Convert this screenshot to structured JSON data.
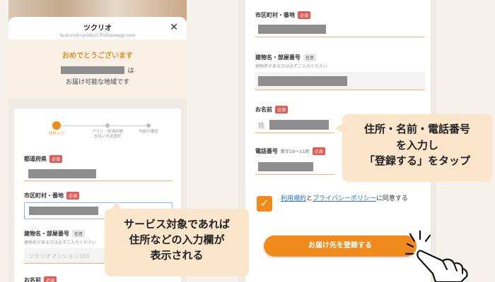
{
  "left": {
    "modal_title": "ツクリオ",
    "modal_url": "tsukurioki-product.firebaseapp.com",
    "congrats_title": "おめでとうございます",
    "congrats_suffix": "は",
    "congrats_sub": "お届け可能な地域です",
    "steps": [
      "住所入力",
      "プラン・配達時間\n支払い方法選択",
      "内容の確認"
    ],
    "fields": {
      "prefecture_label": "都道府県",
      "city_label": "市区町村・番地",
      "building_label": "建物名・部屋番号",
      "building_hint": "建物名がある方は必ずご入力ください",
      "building_placeholder": "ツクリオマンション101",
      "name_label": "お名前"
    },
    "required_badge": "必須",
    "optional_badge": "任意"
  },
  "right": {
    "city_label": "市区町村・番地",
    "building_label": "建物名・部屋番号",
    "building_hint": "建物名がある方は必ずご入力ください",
    "name_label": "お名前",
    "sei_label": "姓",
    "phone_label": "電話番号",
    "phone_hint": "数字10〜11桁",
    "required_badge": "必須",
    "optional_badge": "任意",
    "agree_terms": "利用規約",
    "agree_and": "と",
    "agree_privacy": "プライバシーポリシー",
    "agree_suffix": "に同意する",
    "submit": "お届け先を登録する"
  },
  "bubbles": {
    "left": [
      "サービス対象であれば",
      "住所などの入力欄が",
      "表示される"
    ],
    "right": [
      "住所・名前・電話番号",
      "を入力し",
      "「登録する」をタップ"
    ]
  },
  "colors": {
    "accent": "#f08a1c",
    "bubble": "#fbe6cc",
    "required": "#e25a56",
    "link": "#2a72c4"
  }
}
